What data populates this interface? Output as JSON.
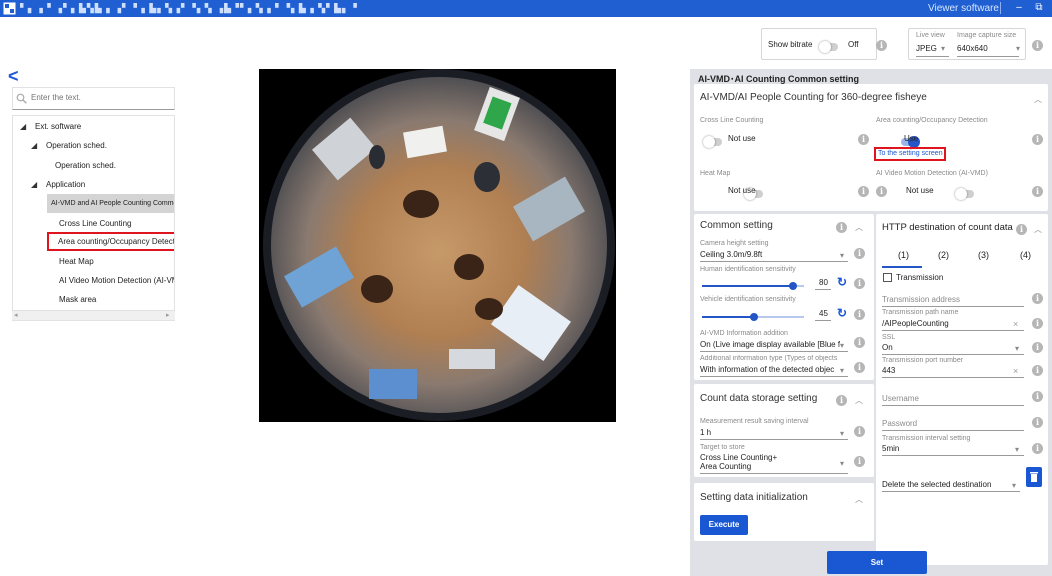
{
  "titlebar": {
    "title": "▘▖▗▝ ▗▘▖▙▚▙ ▖▗▘▝▗ ▙▖▚▗▘▝▖▚ ▗▙▝▘▖▚▗ ▘▝▖▙▗ ▚▘▙▖▝▗ ▚▙▘▗▝▖ ▘▙▖▝ ▗▚▘▙ ▖▝",
    "viewer_label": "Viewer software",
    "minimize": "–",
    "restore": "⧉"
  },
  "top_controls": {
    "show_bitrate_label": "Show bitrate",
    "show_bitrate_value": "Off",
    "live_view_label": "Live view",
    "live_view_value": "JPEG",
    "capture_size_label": "Image capture size",
    "capture_size_value": "640x640"
  },
  "sidebar": {
    "search_placeholder": "Enter the text.",
    "tree": [
      {
        "label": "Ext. software",
        "level": 0,
        "caret": true
      },
      {
        "label": "Operation sched.",
        "level": 1,
        "caret": true
      },
      {
        "label": "Operation sched.",
        "level": 2,
        "caret": false
      },
      {
        "label": "Application",
        "level": 1,
        "caret": true
      },
      {
        "label": "AI-VMD and AI People Counting  Common",
        "level": 2,
        "caret": false,
        "selected": true
      },
      {
        "label": "Cross Line Counting",
        "level": 2,
        "caret": false
      },
      {
        "label": "Area counting/Occupancy Detection",
        "level": 2,
        "caret": false,
        "highlighted": true
      },
      {
        "label": "Heat Map",
        "level": 2,
        "caret": false
      },
      {
        "label": "AI Video Motion Detection (AI-VMD)",
        "level": 2,
        "caret": false
      },
      {
        "label": "Mask area",
        "level": 2,
        "caret": false
      }
    ]
  },
  "settings": {
    "header": "AI-VMD･AI Counting Common setting",
    "section_title": "AI-VMD/AI People Counting for 360-degree fisheye",
    "cross_line_label": "Cross Line Counting",
    "cross_line_value": "Not use",
    "area_counting_label": "Area counting/Occupancy Detection",
    "area_counting_value": "Use",
    "to_setting_screen": "To the setting screen",
    "heat_map_label": "Heat Map",
    "heat_map_value": "Not use",
    "ai_vmd_label": "AI Video Motion Detection (AI-VMD)",
    "ai_vmd_value": "Not use"
  },
  "common_setting": {
    "title": "Common setting",
    "camera_height_label": "Camera height setting",
    "camera_height_value": "Ceiling 3.0m/9.8ft",
    "human_sens_label": "Human identification sensitivity",
    "human_sens_value": 80,
    "vehicle_sens_label": "Vehicle identification sensitivity",
    "vehicle_sens_value": 45,
    "ai_vmd_info_label": "AI-VMD Information addition",
    "ai_vmd_info_value": "On (Live image display available [Blue f",
    "add_info_label": "Additional information type (Types of objects",
    "add_info_value": "With information of the detected objec"
  },
  "storage": {
    "title": "Count data storage setting",
    "interval_label": "Measurement result saving interval",
    "interval_value": "1 h",
    "target_label": "Target to store",
    "target_line1": "Cross Line Counting+",
    "target_line2": "Area Counting"
  },
  "init": {
    "title": "Setting data initialization",
    "execute": "Execute"
  },
  "http": {
    "title": "HTTP destination of count data",
    "tabs": [
      "(1)",
      "(2)",
      "(3)",
      "(4)"
    ],
    "transmission_label": "Transmission",
    "address_placeholder": "Transmission address",
    "path_label": "Transmission path name",
    "path_value": "/AIPeopleCounting",
    "ssl_label": "SSL",
    "ssl_value": "On",
    "port_label": "Transmission port number",
    "port_value": "443",
    "username_placeholder": "Username",
    "password_placeholder": "Password",
    "interval_label": "Transmission interval setting",
    "interval_value": "5min",
    "delete_label": "Delete the selected destination"
  },
  "set_button": "Set",
  "colors": {
    "accent": "#1a57d3",
    "highlight": "#e0141e",
    "titlebar": "#1f5fd1"
  }
}
